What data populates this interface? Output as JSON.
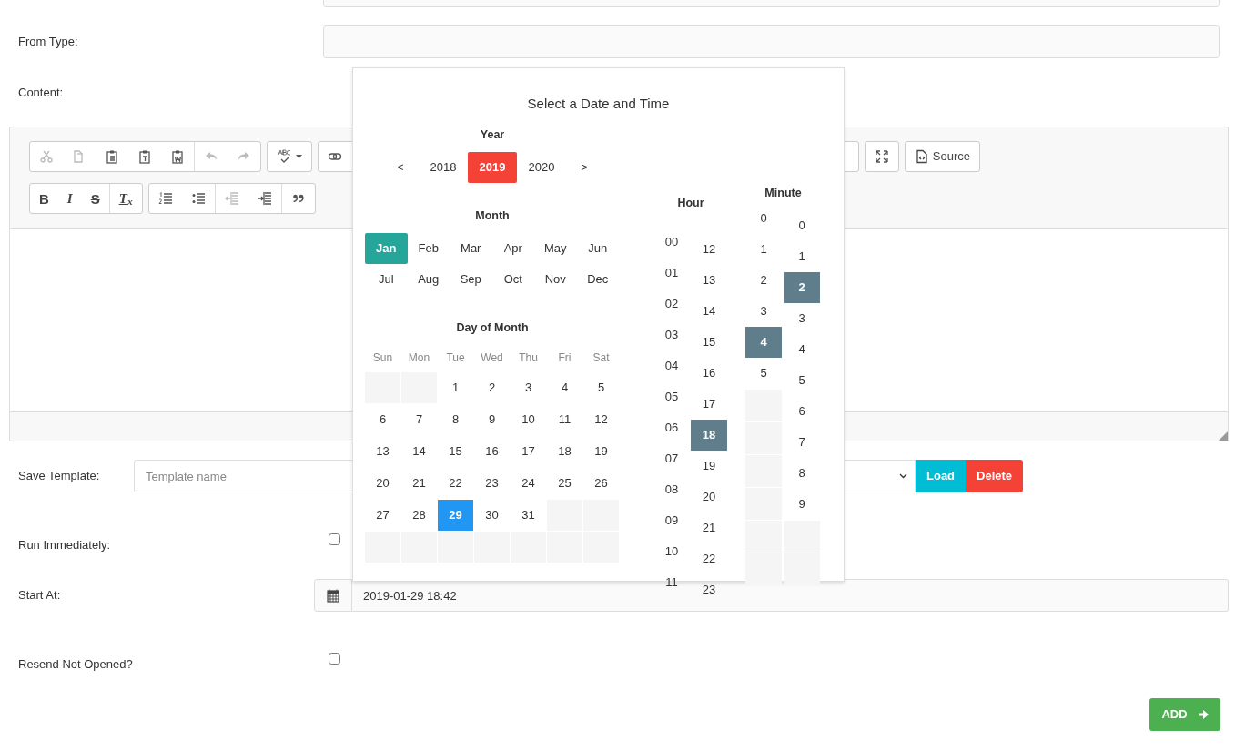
{
  "from_type": {
    "label": "From Type:"
  },
  "content": {
    "label": "Content:",
    "toolbar": [
      [
        {
          "sections": [
            [
              {
                "kind": "cut",
                "disabled": true
              },
              {
                "kind": "copy",
                "disabled": true
              },
              {
                "kind": "paste",
                "disabled": false
              },
              {
                "kind": "paste_text",
                "disabled": false
              },
              {
                "kind": "paste_word",
                "disabled": false
              }
            ],
            [
              {
                "kind": "undo",
                "disabled": true
              },
              {
                "kind": "redo",
                "disabled": true
              }
            ]
          ]
        },
        {
          "sections": [
            [
              {
                "kind": "spellcheck",
                "disabled": false
              }
            ]
          ]
        },
        {
          "sections": [
            [
              {
                "kind": "link",
                "disabled": false
              }
            ]
          ]
        },
        {
          "sections": [
            [
              {
                "kind": "maximize",
                "disabled": false
              }
            ]
          ]
        },
        {
          "sections": [
            [
              {
                "kind": "source",
                "label": "Source",
                "disabled": false
              }
            ]
          ]
        }
      ],
      [
        {
          "sections": [
            [
              {
                "kind": "bold",
                "label": "B",
                "disabled": false
              },
              {
                "kind": "italic",
                "label": "I",
                "disabled": false
              },
              {
                "kind": "strike",
                "label": "S",
                "disabled": false
              }
            ],
            [
              {
                "kind": "remove_format",
                "label": "T$_{x}$",
                "disabled": false
              }
            ]
          ]
        },
        {
          "sections": [
            [
              {
                "kind": "numbered_list",
                "disabled": false
              },
              {
                "kind": "bullet_list",
                "disabled": false
              }
            ],
            [
              {
                "kind": "outdent",
                "disabled": true
              },
              {
                "kind": "indent",
                "disabled": false
              }
            ],
            [
              {
                "kind": "blockquote",
                "disabled": false
              }
            ]
          ]
        }
      ]
    ]
  },
  "save_template": {
    "label": "Save Template:",
    "placeholder": "Template name",
    "buttons": [
      {
        "label": "Load",
        "kind": "load"
      },
      {
        "label": "Delete",
        "kind": "delete"
      }
    ]
  },
  "run_immediately": {
    "label": "Run Immediately:",
    "checked": false
  },
  "start_at": {
    "label": "Start At:",
    "value": "2019-01-29 18:42"
  },
  "resend_not_opened": {
    "label": "Resend Not Opened?",
    "checked": false
  },
  "add_button": {
    "label": "ADD"
  },
  "date_picker": {
    "title": "Select a Date and Time",
    "year": {
      "label": "Year",
      "prev": "<",
      "next": ">",
      "options": [
        {
          "label": "2018",
          "selected": false
        },
        {
          "label": "2019",
          "selected": true
        },
        {
          "label": "2020",
          "selected": false
        }
      ]
    },
    "month": {
      "label": "Month",
      "options": [
        {
          "label": "Jan",
          "selected": true
        },
        {
          "label": "Feb",
          "selected": false
        },
        {
          "label": "Mar",
          "selected": false
        },
        {
          "label": "Apr",
          "selected": false
        },
        {
          "label": "May",
          "selected": false
        },
        {
          "label": "Jun",
          "selected": false
        },
        {
          "label": "Jul",
          "selected": false
        },
        {
          "label": "Aug",
          "selected": false
        },
        {
          "label": "Sep",
          "selected": false
        },
        {
          "label": "Oct",
          "selected": false
        },
        {
          "label": "Nov",
          "selected": false
        },
        {
          "label": "Dec",
          "selected": false
        }
      ]
    },
    "day": {
      "label": "Day of Month",
      "weekdays": [
        "Sun",
        "Mon",
        "Tue",
        "Wed",
        "Thu",
        "Fri",
        "Sat"
      ],
      "weeks": [
        [
          {
            "kind": "blank"
          },
          {
            "kind": "blank"
          },
          {
            "kind": "day",
            "label": "1",
            "selected": false
          },
          {
            "kind": "day",
            "label": "2",
            "selected": false
          },
          {
            "kind": "day",
            "label": "3",
            "selected": false
          },
          {
            "kind": "day",
            "label": "4",
            "selected": false
          },
          {
            "kind": "day",
            "label": "5",
            "selected": false
          }
        ],
        [
          {
            "kind": "day",
            "label": "6",
            "selected": false
          },
          {
            "kind": "day",
            "label": "7",
            "selected": false
          },
          {
            "kind": "day",
            "label": "8",
            "selected": false
          },
          {
            "kind": "day",
            "label": "9",
            "selected": false
          },
          {
            "kind": "day",
            "label": "10",
            "selected": false
          },
          {
            "kind": "day",
            "label": "11",
            "selected": false
          },
          {
            "kind": "day",
            "label": "12",
            "selected": false
          }
        ],
        [
          {
            "kind": "day",
            "label": "13",
            "selected": false
          },
          {
            "kind": "day",
            "label": "14",
            "selected": false
          },
          {
            "kind": "day",
            "label": "15",
            "selected": false
          },
          {
            "kind": "day",
            "label": "16",
            "selected": false
          },
          {
            "kind": "day",
            "label": "17",
            "selected": false
          },
          {
            "kind": "day",
            "label": "18",
            "selected": false
          },
          {
            "kind": "day",
            "label": "19",
            "selected": false
          }
        ],
        [
          {
            "kind": "day",
            "label": "20",
            "selected": false
          },
          {
            "kind": "day",
            "label": "21",
            "selected": false
          },
          {
            "kind": "day",
            "label": "22",
            "selected": false
          },
          {
            "kind": "day",
            "label": "23",
            "selected": false
          },
          {
            "kind": "day",
            "label": "24",
            "selected": false
          },
          {
            "kind": "day",
            "label": "25",
            "selected": false
          },
          {
            "kind": "day",
            "label": "26",
            "selected": false
          }
        ],
        [
          {
            "kind": "day",
            "label": "27",
            "selected": false
          },
          {
            "kind": "day",
            "label": "28",
            "selected": false
          },
          {
            "kind": "day",
            "label": "29",
            "selected": true
          },
          {
            "kind": "day",
            "label": "30",
            "selected": false
          },
          {
            "kind": "day",
            "label": "31",
            "selected": false
          },
          {
            "kind": "blank"
          },
          {
            "kind": "blank"
          }
        ],
        [
          {
            "kind": "blank"
          },
          {
            "kind": "blank"
          },
          {
            "kind": "blank"
          },
          {
            "kind": "blank"
          },
          {
            "kind": "blank"
          },
          {
            "kind": "blank"
          },
          {
            "kind": "blank"
          }
        ]
      ]
    },
    "hour": {
      "label": "Hour",
      "columns": [
        [
          {
            "kind": "time",
            "label": "00",
            "selected": false
          },
          {
            "kind": "time",
            "label": "01",
            "selected": false
          },
          {
            "kind": "time",
            "label": "02",
            "selected": false
          },
          {
            "kind": "time",
            "label": "03",
            "selected": false
          },
          {
            "kind": "time",
            "label": "04",
            "selected": false
          },
          {
            "kind": "time",
            "label": "05",
            "selected": false
          },
          {
            "kind": "time",
            "label": "06",
            "selected": false
          },
          {
            "kind": "time",
            "label": "07",
            "selected": false
          },
          {
            "kind": "time",
            "label": "08",
            "selected": false
          },
          {
            "kind": "time",
            "label": "09",
            "selected": false
          },
          {
            "kind": "time",
            "label": "10",
            "selected": false
          },
          {
            "kind": "time",
            "label": "11",
            "selected": false
          }
        ],
        [
          {
            "kind": "time",
            "label": "12",
            "selected": false
          },
          {
            "kind": "time",
            "label": "13",
            "selected": false
          },
          {
            "kind": "time",
            "label": "14",
            "selected": false
          },
          {
            "kind": "time",
            "label": "15",
            "selected": false
          },
          {
            "kind": "time",
            "label": "16",
            "selected": false
          },
          {
            "kind": "time",
            "label": "17",
            "selected": false
          },
          {
            "kind": "time",
            "label": "18",
            "selected": true
          },
          {
            "kind": "time",
            "label": "19",
            "selected": false
          },
          {
            "kind": "time",
            "label": "20",
            "selected": false
          },
          {
            "kind": "time",
            "label": "21",
            "selected": false
          },
          {
            "kind": "time",
            "label": "22",
            "selected": false
          },
          {
            "kind": "time",
            "label": "23",
            "selected": false
          }
        ]
      ]
    },
    "minute": {
      "label": "Minute",
      "columns": [
        [
          {
            "kind": "time",
            "label": "0",
            "selected": false
          },
          {
            "kind": "time",
            "label": "1",
            "selected": false
          },
          {
            "kind": "time",
            "label": "2",
            "selected": false
          },
          {
            "kind": "time",
            "label": "3",
            "selected": false
          },
          {
            "kind": "time",
            "label": "4",
            "selected": true
          },
          {
            "kind": "time",
            "label": "5",
            "selected": false
          },
          {
            "kind": "blank"
          },
          {
            "kind": "blank"
          },
          {
            "kind": "blank"
          },
          {
            "kind": "blank"
          },
          {
            "kind": "blank"
          },
          {
            "kind": "blank"
          }
        ],
        [
          {
            "kind": "time",
            "label": "0",
            "selected": false
          },
          {
            "kind": "time",
            "label": "1",
            "selected": false
          },
          {
            "kind": "time",
            "label": "2",
            "selected": true
          },
          {
            "kind": "time",
            "label": "3",
            "selected": false
          },
          {
            "kind": "time",
            "label": "4",
            "selected": false
          },
          {
            "kind": "time",
            "label": "5",
            "selected": false
          },
          {
            "kind": "time",
            "label": "6",
            "selected": false
          },
          {
            "kind": "time",
            "label": "7",
            "selected": false
          },
          {
            "kind": "time",
            "label": "8",
            "selected": false
          },
          {
            "kind": "time",
            "label": "9",
            "selected": false
          },
          {
            "kind": "blank"
          },
          {
            "kind": "blank"
          }
        ]
      ]
    }
  }
}
